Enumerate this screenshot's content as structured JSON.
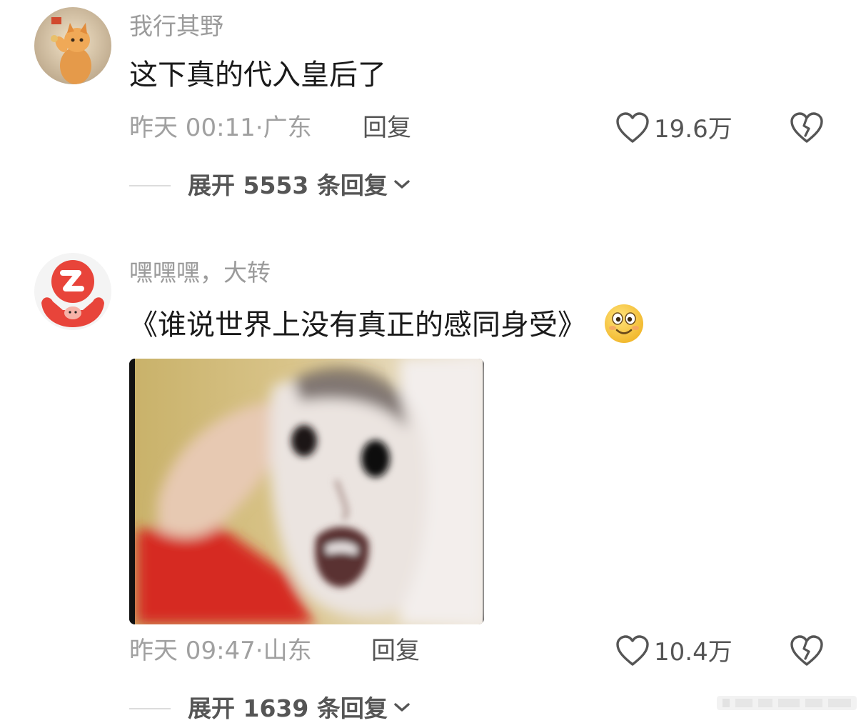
{
  "comments": [
    {
      "username": "我行其野",
      "text": "这下真的代入皇后了",
      "time": "昨天 00:11·",
      "location": "广东",
      "reply_label": "回复",
      "likes": "19.6万",
      "expand_label": "展开 5553 条回复"
    },
    {
      "username": "嘿嘿嘿，大转",
      "text": "《谁说世界上没有真正的感同身受》",
      "time": "昨天 09:47·",
      "location": "山东",
      "reply_label": "回复",
      "likes": "10.4万",
      "expand_label": "展开 1639 条回复",
      "emoji": "smiling-face-emoji"
    }
  ],
  "colors": {
    "meta_gray": "#a0a0a0",
    "username_gray": "#9b9b9b",
    "text_black": "#1a1a1a",
    "avatar_red": "#e8443a"
  }
}
